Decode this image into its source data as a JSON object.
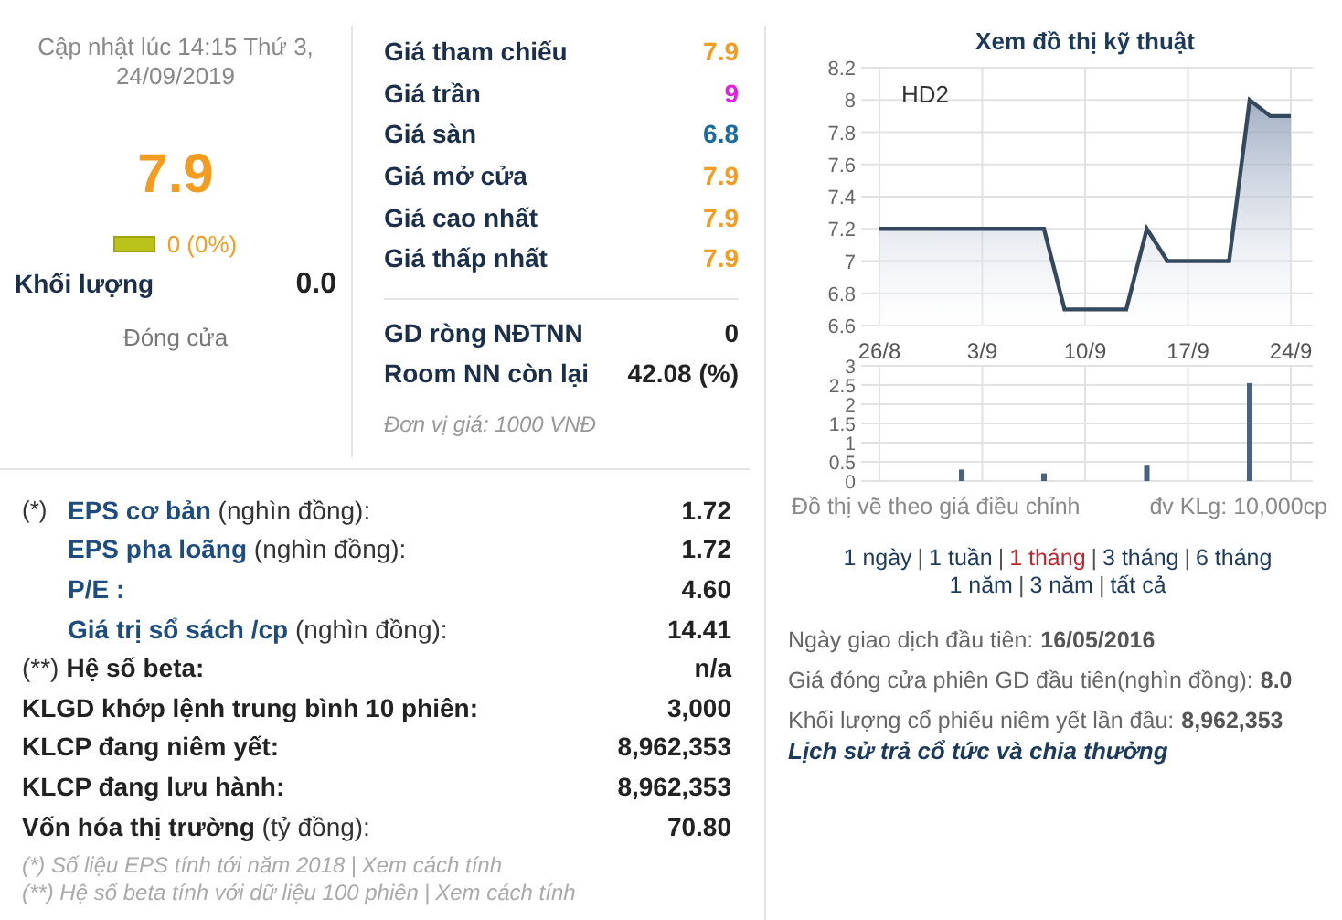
{
  "quote": {
    "updated": "Cập nhật lúc 14:15 Thứ 3, 24/09/2019",
    "price": "7.9",
    "change": "0 (0%)",
    "volume_label": "Khối lượng",
    "volume": "0.0",
    "status": "Đóng cửa"
  },
  "prices": [
    {
      "label": "Giá tham chiếu",
      "value": "7.9",
      "color": "#f39c1f"
    },
    {
      "label": "Giá trần",
      "value": "9",
      "color": "#e21ee0"
    },
    {
      "label": "Giá sàn",
      "value": "6.8",
      "color": "#1b6c9e"
    },
    {
      "label": "Giá mở cửa",
      "value": "7.9",
      "color": "#f39c1f"
    },
    {
      "label": "Giá cao nhất",
      "value": "7.9",
      "color": "#f39c1f"
    },
    {
      "label": "Giá thấp nhất",
      "value": "7.9",
      "color": "#f39c1f"
    }
  ],
  "foreign": [
    {
      "label": "GD ròng NĐTNN",
      "value": "0"
    },
    {
      "label": "Room NN còn lại",
      "value": "42.08 (%)"
    }
  ],
  "unit_note": "Đơn vị giá: 1000 VNĐ",
  "stats": [
    {
      "kind": "sub",
      "prefix": "(*)",
      "label": "**EPS cơ bản** (nghìn đồng):",
      "value": "1.72"
    },
    {
      "kind": "sub",
      "label": "**EPS pha loãng** (nghìn đồng):",
      "value": "1.72"
    },
    {
      "kind": "sub",
      "label": "**P/E :**",
      "value": "4.60"
    },
    {
      "kind": "sub",
      "label": "**Giá trị sổ sách /cp** (nghìn đồng):",
      "value": "14.41"
    },
    {
      "kind": "main",
      "prefix": "(**)",
      "label": "**Hệ số beta:**",
      "value": "n/a"
    },
    {
      "kind": "main",
      "label": "**KLGD khớp lệnh trung bình 10 phiên:**",
      "value": "3,000"
    },
    {
      "kind": "main",
      "label": "**KLCP đang niêm yết:**",
      "value": "8,962,353"
    },
    {
      "kind": "main",
      "label": "**KLCP đang lưu hành:**",
      "value": "8,962,353"
    },
    {
      "kind": "main",
      "label": "**Vốn hóa thị trường** (tỷ đồng):",
      "value": "70.80"
    }
  ],
  "notes": [
    {
      "text": "(*) Số liệu EPS tính tới năm 2018",
      "separator": "|",
      "link": "Xem cách tính"
    },
    {
      "text": "(**) Hệ số beta tính với dữ liệu 100 phiên",
      "separator": "|",
      "link": "Xem cách tính"
    }
  ],
  "chart_panel": {
    "title": "Xem đồ thị kỹ thuật",
    "price_chart": {
      "chart_data": {
        "type": "area",
        "categories": [
          "26/8",
          null,
          null,
          null,
          null,
          "3/9",
          null,
          null,
          null,
          null,
          "10/9",
          null,
          null,
          null,
          null,
          "17/9",
          null,
          null,
          null,
          null,
          "24/9"
        ],
        "series": [
          {
            "name": "HD2",
            "color": "#34495e",
            "values": [
              7.2,
              7.2,
              7.2,
              7.2,
              7.2,
              7.2,
              7.2,
              7.2,
              7.2,
              6.7,
              6.7,
              6.7,
              6.7,
              7.2,
              7.0,
              7.0,
              7.0,
              7.0,
              8.0,
              7.9,
              7.9
            ]
          }
        ],
        "grid": true,
        "ylim": [
          6.6,
          8.2
        ],
        "yticks": [
          6.6,
          6.8,
          7,
          7.2,
          7.4,
          7.6,
          7.8,
          8,
          8.2
        ]
      }
    },
    "volume_chart": {
      "chart_data": {
        "type": "bar",
        "categories": [
          null,
          null,
          null,
          null,
          null,
          null,
          null,
          null,
          null,
          null,
          null,
          null,
          null,
          null,
          null,
          null,
          null,
          null,
          null,
          null,
          null
        ],
        "series": [
          {
            "color": "#4a6282",
            "values": [
              null,
              null,
              null,
              null,
              0.3,
              null,
              null,
              null,
              0.2,
              null,
              null,
              null,
              null,
              0.4,
              null,
              null,
              null,
              null,
              2.55,
              null,
              null
            ]
          }
        ],
        "grid": true,
        "ylim": [
          0,
          3
        ],
        "yticks": [
          0,
          0.5,
          1,
          1.5,
          2,
          2.5,
          3
        ]
      }
    },
    "adjusted_note": "Đồ thị vẽ theo giá điều chỉnh",
    "volume_unit": "đv KLg: 10,000cp"
  },
  "ranges": {
    "separator": "|",
    "items": [
      {
        "label": "1 ngày",
        "selected": false
      },
      {
        "label": "1 tuần",
        "selected": false
      },
      {
        "label": "1 tháng",
        "selected": true
      },
      {
        "label": "3 tháng",
        "selected": false
      },
      {
        "label": "6 tháng",
        "selected": false
      },
      {
        "label": "1 năm",
        "selected": false,
        "new_line": true
      },
      {
        "label": "3 năm",
        "selected": false
      },
      {
        "label": "tất cả",
        "selected": false
      }
    ]
  },
  "listing": [
    {
      "label": "Ngày giao dịch đầu tiên:",
      "value": "16/05/2016"
    },
    {
      "label": "Giá đóng cửa phiên GD đầu tiên(nghìn đồng):",
      "value": "8.0"
    },
    {
      "label": "Khối lượng cổ phiếu niêm yết lần đầu:",
      "value": "8,962,353"
    }
  ],
  "dividend_link": "Lịch sử trả cổ tức và chia thưởng"
}
